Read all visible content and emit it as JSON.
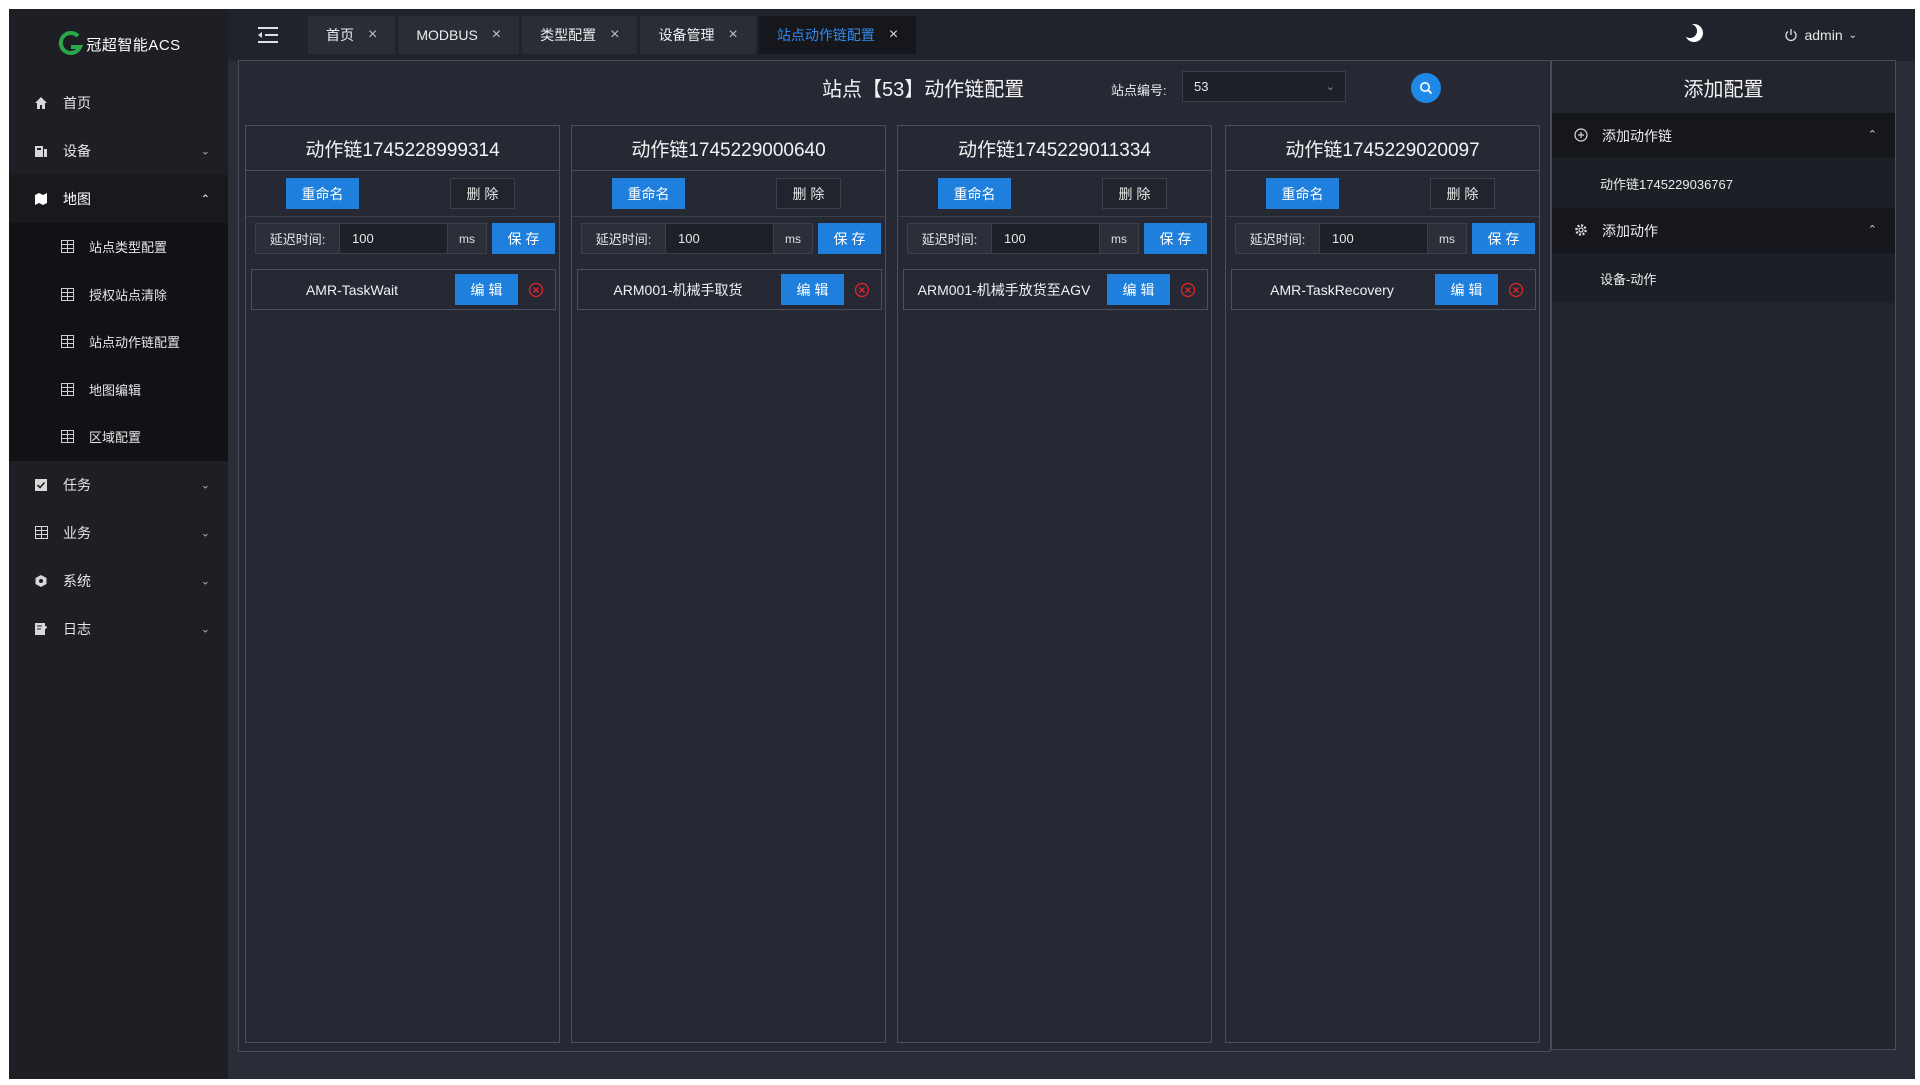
{
  "app": {
    "logo_letter": "G",
    "logo_text": "冠超智能ACS"
  },
  "sidebar": {
    "items": [
      {
        "label": "首页",
        "icon": "home-icon"
      },
      {
        "label": "设备",
        "icon": "device-icon"
      },
      {
        "label": "地图",
        "icon": "map-icon"
      },
      {
        "label": "任务",
        "icon": "task-icon"
      },
      {
        "label": "业务",
        "icon": "business-icon"
      },
      {
        "label": "系统",
        "icon": "system-icon"
      },
      {
        "label": "日志",
        "icon": "log-icon"
      }
    ],
    "map_submenu": [
      {
        "label": "站点类型配置"
      },
      {
        "label": "授权站点清除"
      },
      {
        "label": "站点动作链配置"
      },
      {
        "label": "地图编辑"
      },
      {
        "label": "区域配置"
      }
    ]
  },
  "topbar": {
    "tabs": [
      {
        "label": "首页"
      },
      {
        "label": "MODBUS"
      },
      {
        "label": "类型配置"
      },
      {
        "label": "设备管理"
      },
      {
        "label": "站点动作链配置"
      }
    ],
    "active_tab": "站点动作链配置",
    "user": "admin"
  },
  "main": {
    "title": "站点【53】动作链配置",
    "station_label": "站点编号:",
    "station_value": "53",
    "chains": [
      {
        "title": "动作链1745228999314",
        "rename": "重命名",
        "delete": "删 除",
        "delay_label": "延迟时间:",
        "delay_value": "100",
        "delay_unit": "ms",
        "save": "保 存",
        "action": "AMR-TaskWait",
        "edit": "编 辑"
      },
      {
        "title": "动作链1745229000640",
        "rename": "重命名",
        "delete": "删 除",
        "delay_label": "延迟时间:",
        "delay_value": "100",
        "delay_unit": "ms",
        "save": "保 存",
        "action": "ARM001-机械手取货",
        "edit": "编 辑"
      },
      {
        "title": "动作链1745229011334",
        "rename": "重命名",
        "delete": "删 除",
        "delay_label": "延迟时间:",
        "delay_value": "100",
        "delay_unit": "ms",
        "save": "保 存",
        "action": "ARM001-机械手放货至AGV",
        "edit": "编 辑"
      },
      {
        "title": "动作链1745229020097",
        "rename": "重命名",
        "delete": "删 除",
        "delay_label": "延迟时间:",
        "delay_value": "100",
        "delay_unit": "ms",
        "save": "保 存",
        "action": "AMR-TaskRecovery",
        "edit": "编 辑"
      }
    ]
  },
  "right_panel": {
    "title": "添加配置",
    "sections": [
      {
        "header": "添加动作链",
        "icon": "plus-circle-icon",
        "items": [
          "动作链1745229036767"
        ]
      },
      {
        "header": "添加动作",
        "icon": "gear-icon",
        "items": [
          "设备-动作"
        ]
      }
    ]
  },
  "colors": {
    "accent": "#1e80dc",
    "active_tab_text": "#2e8bf0",
    "logo_green": "#2aa84a",
    "remove_red": "#e0262a"
  }
}
